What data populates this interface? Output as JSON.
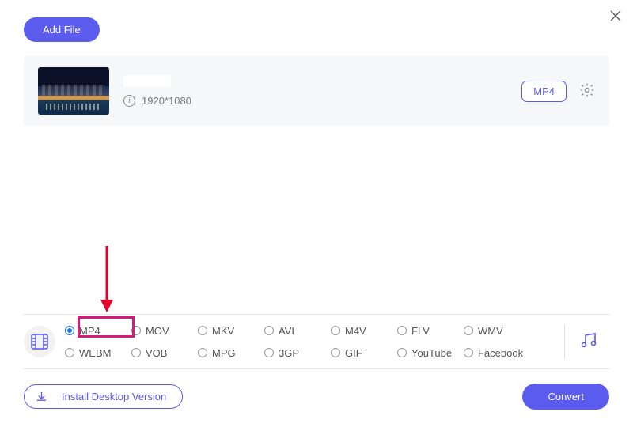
{
  "header": {
    "add_file_label": "Add File"
  },
  "file": {
    "resolution": "1920*1080",
    "format_label": "MP4"
  },
  "formats": {
    "selected": "MP4",
    "row1": [
      "MP4",
      "MOV",
      "MKV",
      "AVI",
      "M4V",
      "FLV",
      "WMV"
    ],
    "row2": [
      "WEBM",
      "VOB",
      "MPG",
      "3GP",
      "GIF",
      "YouTube",
      "Facebook"
    ]
  },
  "footer": {
    "install_label": "Install Desktop Version",
    "convert_label": "Convert"
  }
}
